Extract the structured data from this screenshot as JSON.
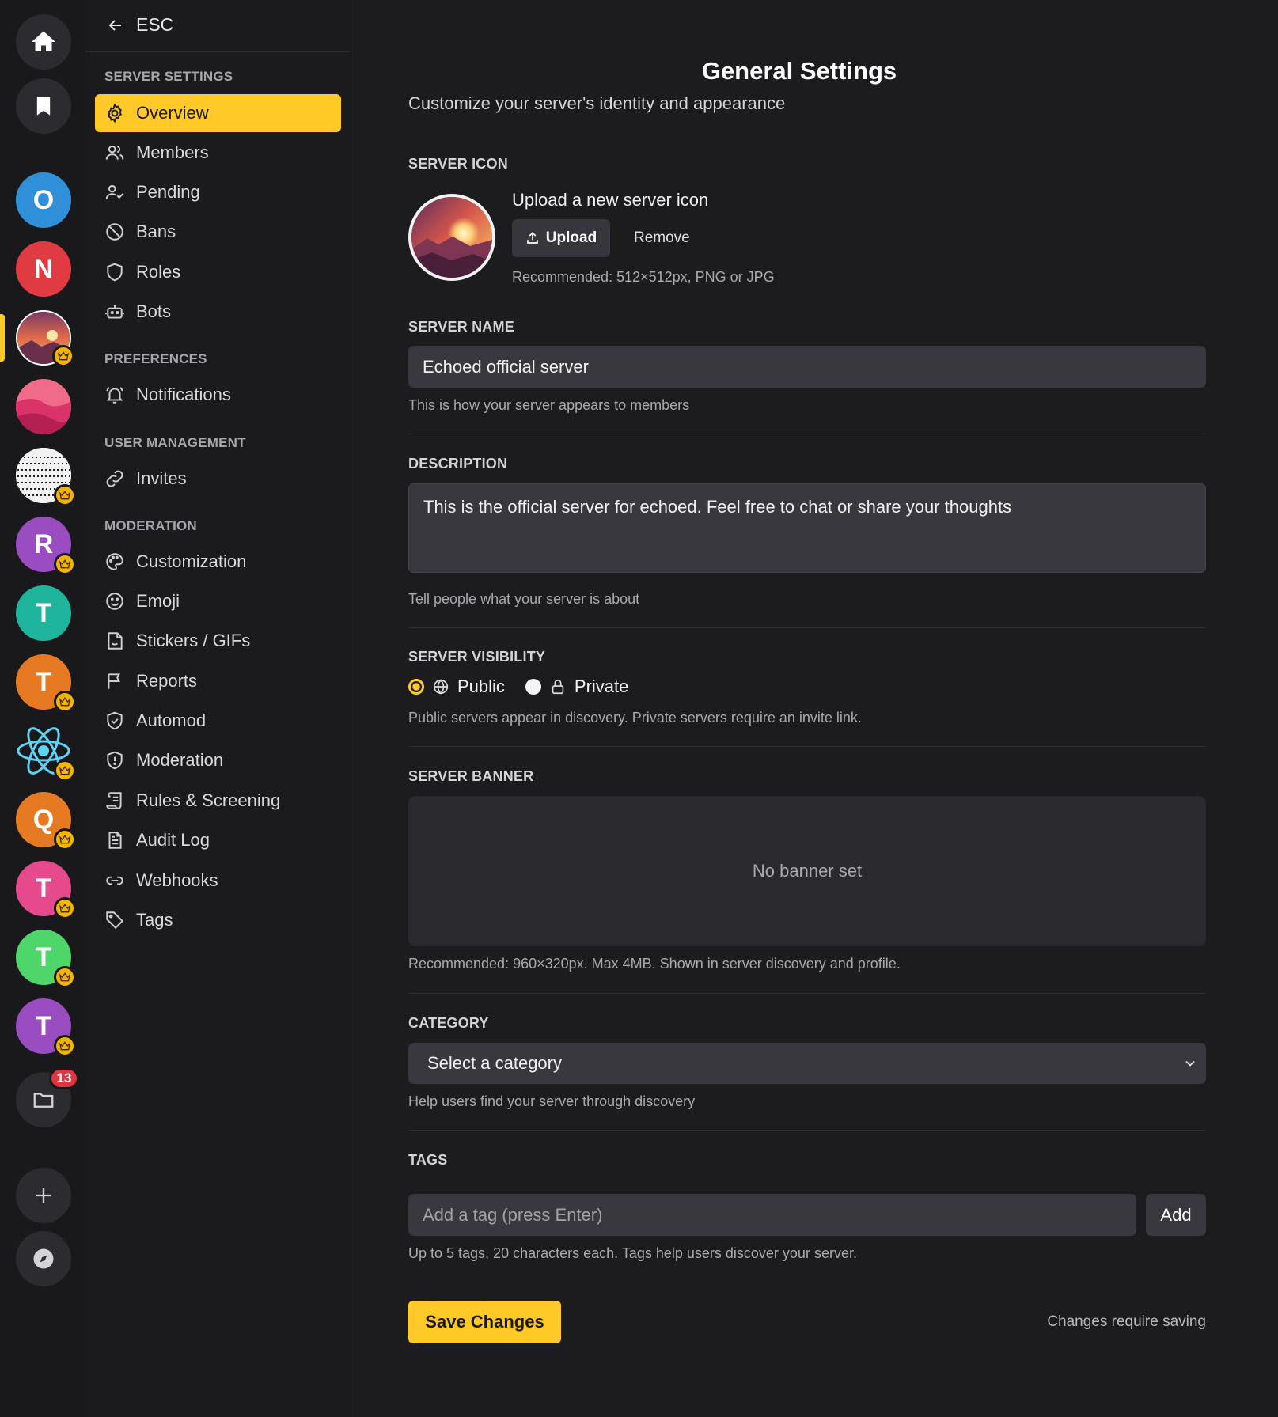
{
  "colors": {
    "accent": "#ffc928",
    "background": "#1c1c1f",
    "rail": "#19191b",
    "input": "#38383e",
    "badge_red": "#e0343f"
  },
  "rail": {
    "items": [
      {
        "kind": "icon",
        "icon": "home-icon"
      },
      {
        "kind": "icon",
        "icon": "bookmark-icon"
      },
      {
        "kind": "letter",
        "letter": "O",
        "color": "#2f8fd8"
      },
      {
        "kind": "letter",
        "letter": "N",
        "color": "#e03a42"
      },
      {
        "kind": "image",
        "image": "sunset-mountain",
        "crown": true,
        "active": true
      },
      {
        "kind": "image",
        "image": "pink-landscape"
      },
      {
        "kind": "image",
        "image": "noise-pattern",
        "crown": true
      },
      {
        "kind": "letter",
        "letter": "R",
        "color": "#9a4dc0",
        "crown": true
      },
      {
        "kind": "letter",
        "letter": "T",
        "color": "#1fb59c"
      },
      {
        "kind": "letter",
        "letter": "T",
        "color": "#e67a22",
        "crown": true
      },
      {
        "kind": "image",
        "image": "react-logo",
        "crown": true
      },
      {
        "kind": "letter",
        "letter": "Q",
        "color": "#e67a22",
        "crown": true
      },
      {
        "kind": "letter",
        "letter": "T",
        "color": "#e64a8c",
        "crown": true
      },
      {
        "kind": "letter",
        "letter": "T",
        "color": "#4fd66a",
        "crown": true
      },
      {
        "kind": "letter",
        "letter": "T",
        "color": "#9a4dc0",
        "crown": true
      },
      {
        "kind": "folder",
        "icon": "folder-icon",
        "badge": "13"
      },
      {
        "kind": "icon",
        "icon": "plus-icon"
      },
      {
        "kind": "icon",
        "icon": "compass-icon"
      }
    ]
  },
  "nav": {
    "back_label": "ESC",
    "sections": {
      "server_settings": "SERVER SETTINGS",
      "preferences": "PREFERENCES",
      "user_management": "USER MANAGEMENT",
      "moderation": "MODERATION"
    },
    "items": {
      "overview": "Overview",
      "members": "Members",
      "pending": "Pending",
      "bans": "Bans",
      "roles": "Roles",
      "bots": "Bots",
      "notifications": "Notifications",
      "invites": "Invites",
      "customization": "Customization",
      "emoji": "Emoji",
      "stickers": "Stickers / GIFs",
      "reports": "Reports",
      "automod": "Automod",
      "moderation": "Moderation",
      "rules": "Rules & Screening",
      "audit_log": "Audit Log",
      "webhooks": "Webhooks",
      "tags": "Tags"
    }
  },
  "main": {
    "title": "General Settings",
    "subtitle": "Customize your server's identity and appearance",
    "server_icon": {
      "label": "SERVER ICON",
      "heading": "Upload a new server icon",
      "upload_label": "Upload",
      "remove_label": "Remove",
      "help": "Recommended: 512×512px, PNG or JPG"
    },
    "server_name": {
      "label": "SERVER NAME",
      "value": "Echoed official server",
      "help": "This is how your server appears to members"
    },
    "description": {
      "label": "DESCRIPTION",
      "value": "This is the official server for echoed. Feel free to chat or share your thoughts",
      "help": "Tell people what your server is about"
    },
    "visibility": {
      "label": "SERVER VISIBILITY",
      "public_label": "Public",
      "private_label": "Private",
      "selected": "Public",
      "help": "Public servers appear in discovery. Private servers require an invite link."
    },
    "banner": {
      "label": "SERVER BANNER",
      "empty_text": "No banner set",
      "help": "Recommended: 960×320px. Max 4MB. Shown in server discovery and profile."
    },
    "category": {
      "label": "CATEGORY",
      "selected": "Select a category",
      "help": "Help users find your server through discovery"
    },
    "tags": {
      "label": "TAGS",
      "placeholder": "Add a tag (press Enter)",
      "add_label": "Add",
      "help": "Up to 5 tags, 20 characters each. Tags help users discover your server."
    },
    "save_label": "Save Changes",
    "save_hint": "Changes require saving"
  }
}
